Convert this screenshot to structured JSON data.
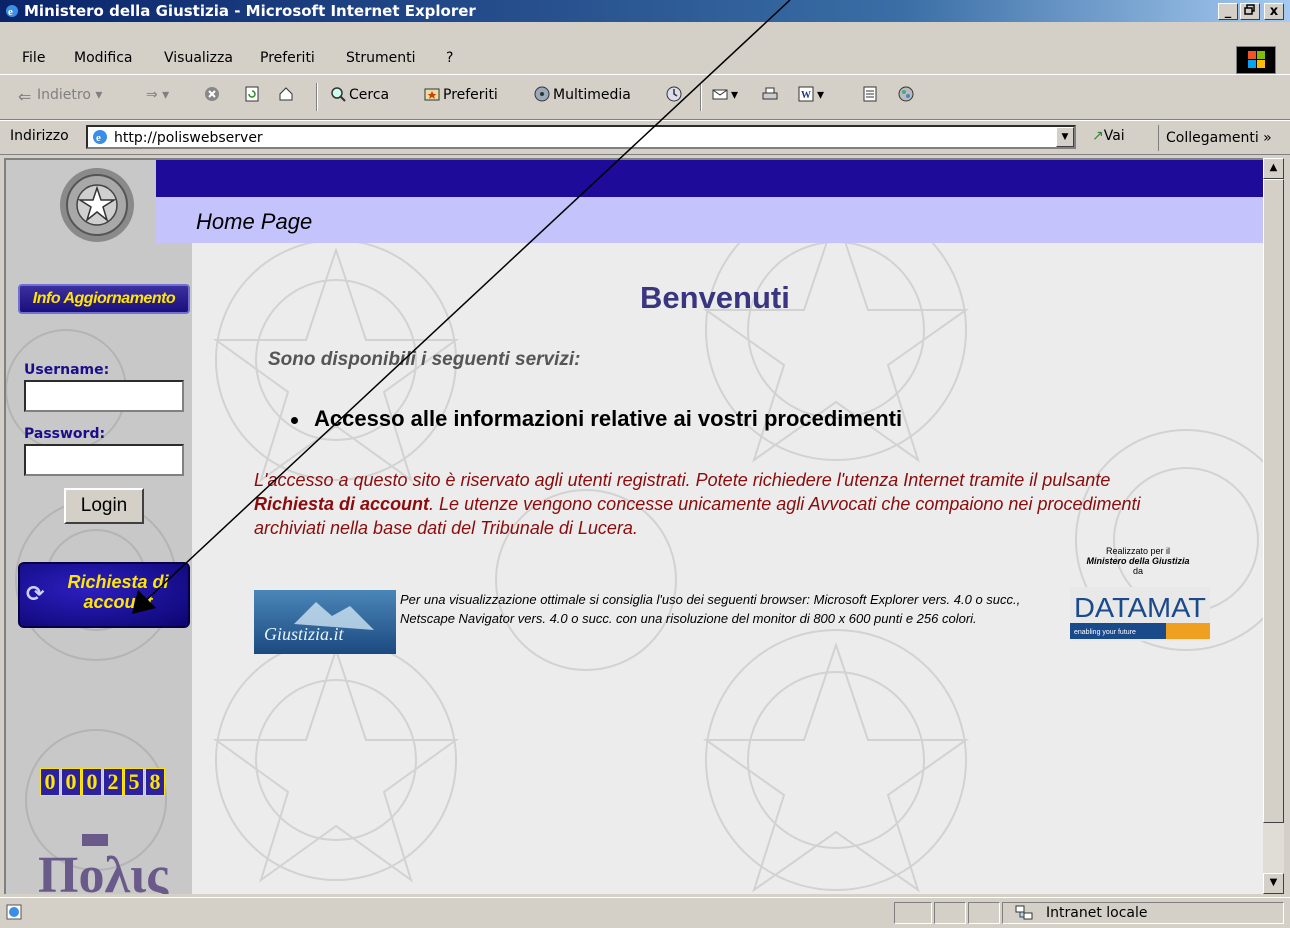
{
  "window": {
    "title": "Ministero della Giustizia - Microsoft Internet Explorer",
    "min_label": "_",
    "max_label": " ",
    "close_label": "x"
  },
  "menu": {
    "items": [
      {
        "label": "File"
      },
      {
        "label": "Modifica"
      },
      {
        "label": "Visualizza"
      },
      {
        "label": "Preferiti"
      },
      {
        "label": "Strumenti"
      },
      {
        "label": "?"
      }
    ]
  },
  "toolbar": {
    "back": "Indietro",
    "search": "Cerca",
    "favorites": "Preferiti",
    "media": "Multimedia"
  },
  "address": {
    "label": "Indirizzo",
    "url": "http://poliswebserver",
    "go": "Vai",
    "links": "Collegamenti"
  },
  "page": {
    "home_title": "Home Page",
    "info_button": "Info Aggiornamento",
    "username_label": "Username:",
    "password_label": "Password:",
    "username_value": "",
    "password_value": "",
    "login_button": "Login",
    "request_line1": "Richiesta di",
    "request_line2": "account",
    "counter_digits": [
      "0",
      "0",
      "0",
      "2",
      "5",
      "8"
    ],
    "welcome": "Benvenuti",
    "services_heading": "Sono disponibili i seguenti servizi:",
    "service_item": "Accesso alle informazioni relative ai vostri procedimenti",
    "notice_part1": "L'accesso a questo sito è riservato agli utenti registrati. Potete richiedere l'utenza Internet tramite il pulsante ",
    "notice_bold": "Richiesta di account",
    "notice_part2": ". Le utenze vengono concesse unicamente agli Avvocati che compaiono nei procedimenti archiviati nella base dati del Tribunale di Lucera.",
    "giustizia_logo_text": "Giustizia.it",
    "browser_note": "Per una visualizzazione ottimale si consiglia l'uso dei seguenti browser: Microsoft Explorer vers. 4.0 o succ., Netscape Navigator vers. 4.0 o succ. con una risoluzione del monitor di 800 x 600 punti e 256 colori.",
    "realizzato_line1": "Realizzato per il",
    "realizzato_line2": "Ministero della Giustizia",
    "realizzato_line3": "da",
    "datamat_logo": "DATAMAT",
    "datamat_tagline": "enabling your future",
    "polis_logo": "Πολις"
  },
  "status": {
    "zone": "Intranet locale"
  },
  "colors": {
    "title_bar": "#0a246a",
    "header_band": "#1e0b99",
    "home_band": "#c5c3fb",
    "notice_text": "#8a0c0c",
    "button_text": "#ffe600"
  }
}
